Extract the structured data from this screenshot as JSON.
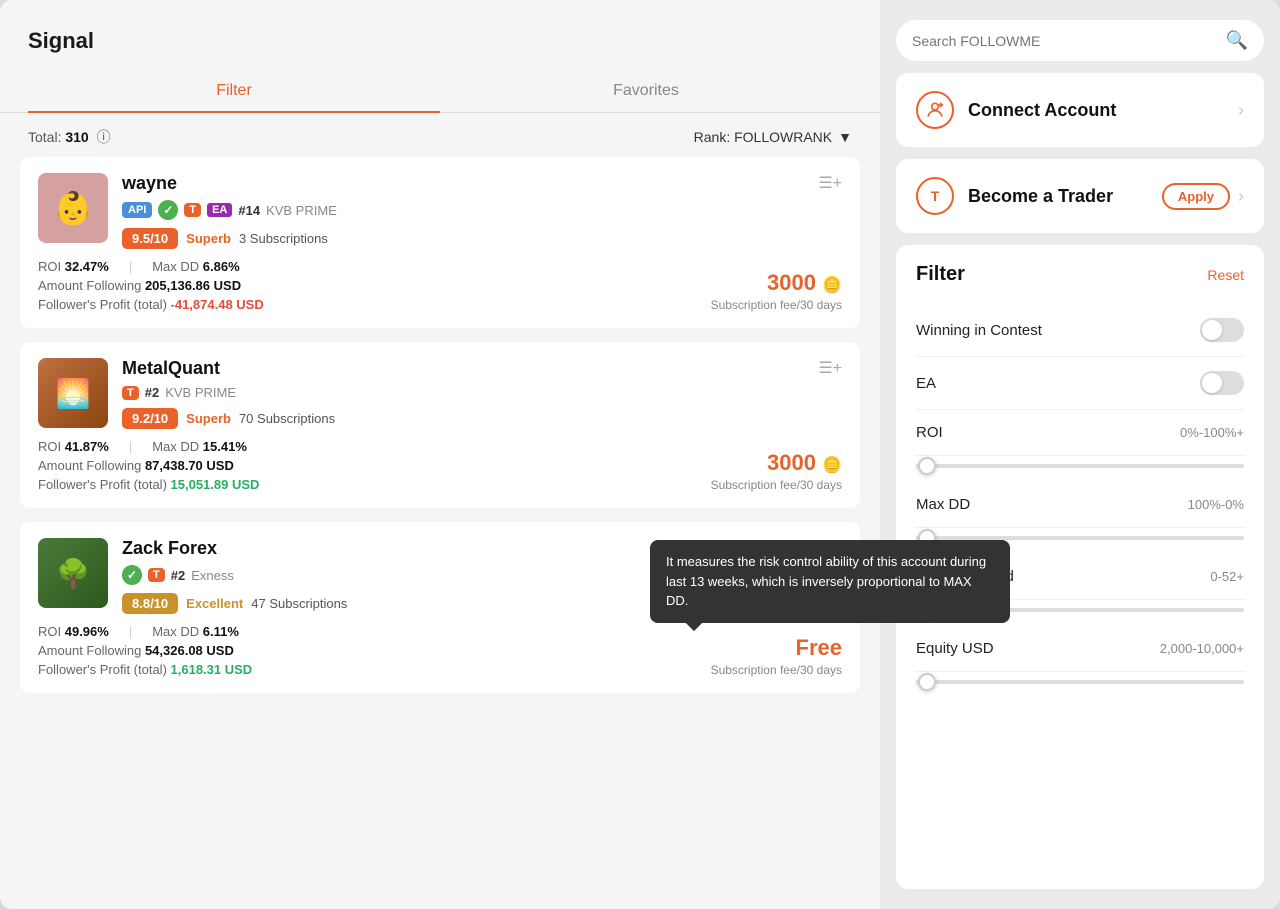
{
  "app": {
    "title": "Signal"
  },
  "search": {
    "placeholder": "Search FOLLOWME"
  },
  "tabs": {
    "filter": "Filter",
    "favorites": "Favorites",
    "active": "filter"
  },
  "list_header": {
    "total_label": "Total:",
    "total_count": "310",
    "info_icon": "ⓘ",
    "rank_label": "Rank: FOLLOWRANK",
    "dropdown_icon": "▼"
  },
  "actions": {
    "connect_account": {
      "title": "Connect Account",
      "icon": "👤"
    },
    "become_trader": {
      "title": "Become a Trader",
      "apply_label": "Apply",
      "icon": "T"
    }
  },
  "filter": {
    "title": "Filter",
    "reset_label": "Reset",
    "items": [
      {
        "label": "Winning in Contest",
        "type": "toggle",
        "value": ""
      },
      {
        "label": "EA",
        "type": "toggle",
        "value": ""
      },
      {
        "label": "ROI",
        "type": "range",
        "value": "0%-100%+"
      },
      {
        "label": "Max DD",
        "type": "range",
        "value": "100%-0%"
      },
      {
        "label": "Trading Period",
        "type": "range",
        "value": "0-52+"
      },
      {
        "label": "Equity USD",
        "type": "range",
        "value": "2,000-10,000+"
      }
    ]
  },
  "tooltip": {
    "text": "It measures the risk control ability of this account during last 13 weeks, which is inversely proportional to MAX DD."
  },
  "traders": [
    {
      "id": 1,
      "name": "wayne",
      "avatar_bg": "#d4a0a0",
      "avatar_emoji": "👶",
      "badges": [
        "API",
        "✓",
        "T",
        "EA"
      ],
      "rank": "#14",
      "broker": "KVB PRIME",
      "score": "9.5/10",
      "score_type": "superb",
      "quality": "Superb",
      "subscriptions": "3 Subscriptions",
      "roi": "32.47%",
      "max_dd": "6.86%",
      "amount_following": "205,136.86 USD",
      "followers_profit": "-41,874.48 USD",
      "followers_profit_positive": false,
      "price": "3000",
      "price_unit": "Subscription fee/30 days",
      "coin_icon": "🪙"
    },
    {
      "id": 2,
      "name": "MetalQuant",
      "avatar_bg": "#c08040",
      "avatar_emoji": "🌅",
      "badges": [
        "T"
      ],
      "rank": "#2",
      "broker": "KVB PRIME",
      "score": "9.2/10",
      "score_type": "superb",
      "quality": "Superb",
      "subscriptions": "70 Subscriptions",
      "roi": "41.87%",
      "max_dd": "15.41%",
      "amount_following": "87,438.70 USD",
      "followers_profit": "15,051.89 USD",
      "followers_profit_positive": true,
      "price": "3000",
      "price_unit": "Subscription fee/30 days",
      "coin_icon": "🪙"
    },
    {
      "id": 3,
      "name": "Zack Forex",
      "avatar_bg": "#5a8a4a",
      "avatar_emoji": "🌳",
      "badges": [
        "✓",
        "T"
      ],
      "rank": "#2",
      "broker": "Exness",
      "score": "8.8/10",
      "score_type": "excellent",
      "quality": "Excellent",
      "subscriptions": "47 Subscriptions",
      "roi": "49.96%",
      "max_dd": "6.11%",
      "amount_following": "54,326.08 USD",
      "followers_profit": "1,618.31 USD",
      "followers_profit_positive": true,
      "price": "Free",
      "price_unit": "Subscription fee/30 days",
      "is_free": true
    }
  ]
}
